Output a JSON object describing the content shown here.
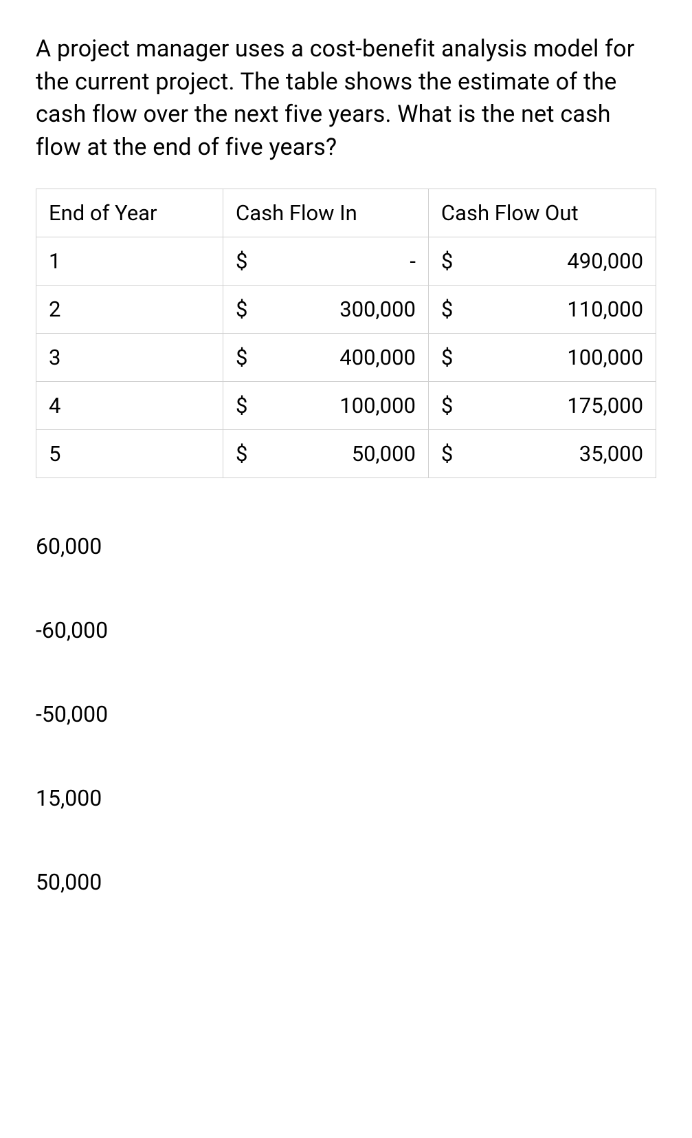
{
  "question": "A project manager uses a cost-benefit analysis model for the current project. The table shows the estimate of the cash flow over the next five years. What is the net cash flow at the end of five years?",
  "table": {
    "headers": [
      "End of Year",
      "Cash Flow In",
      "Cash Flow Out"
    ],
    "rows": [
      {
        "year": "1",
        "in_currency": "$",
        "in_value": "-",
        "out_currency": "$",
        "out_value": "490,000"
      },
      {
        "year": "2",
        "in_currency": "$",
        "in_value": "300,000",
        "out_currency": "$",
        "out_value": "110,000"
      },
      {
        "year": "3",
        "in_currency": "$",
        "in_value": "400,000",
        "out_currency": "$",
        "out_value": "100,000"
      },
      {
        "year": "4",
        "in_currency": "$",
        "in_value": "100,000",
        "out_currency": "$",
        "out_value": "175,000"
      },
      {
        "year": "5",
        "in_currency": "$",
        "in_value": "50,000",
        "out_currency": "$",
        "out_value": "35,000"
      }
    ]
  },
  "options": [
    "60,000",
    "-60,000",
    "-50,000",
    "15,000",
    "50,000"
  ]
}
